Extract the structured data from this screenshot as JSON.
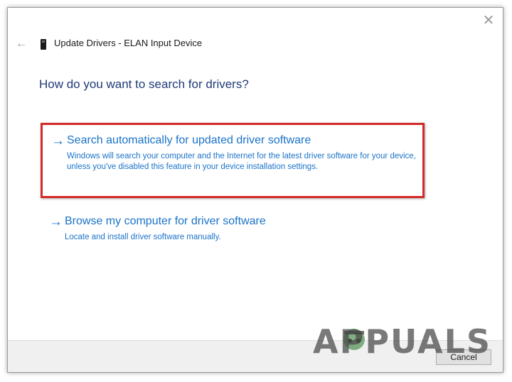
{
  "window": {
    "title": "Update Drivers - ELAN Input Device",
    "close_glyph": "✕",
    "back_glyph": "←"
  },
  "main": {
    "question": "How do you want to search for drivers?",
    "options": [
      {
        "arrow": "→",
        "title": "Search automatically for updated driver software",
        "description": "Windows will search your computer and the Internet for the latest driver software for your device, unless you've disabled this feature in your device installation settings.",
        "highlighted": true
      },
      {
        "arrow": "→",
        "title": "Browse my computer for driver software",
        "description": "Locate and install driver software manually.",
        "highlighted": false
      }
    ]
  },
  "footer": {
    "cancel_label": "Cancel"
  },
  "watermark": {
    "text": "APPUALS"
  },
  "colors": {
    "link_blue": "#1a73c8",
    "heading_navy": "#1f3a78",
    "highlight_red": "#d32a2a",
    "footer_gray": "#f0f0f0"
  },
  "icons": {
    "back": "back-arrow-icon",
    "close": "close-icon",
    "device": "input-device-icon",
    "option_arrow": "right-arrow-icon"
  }
}
